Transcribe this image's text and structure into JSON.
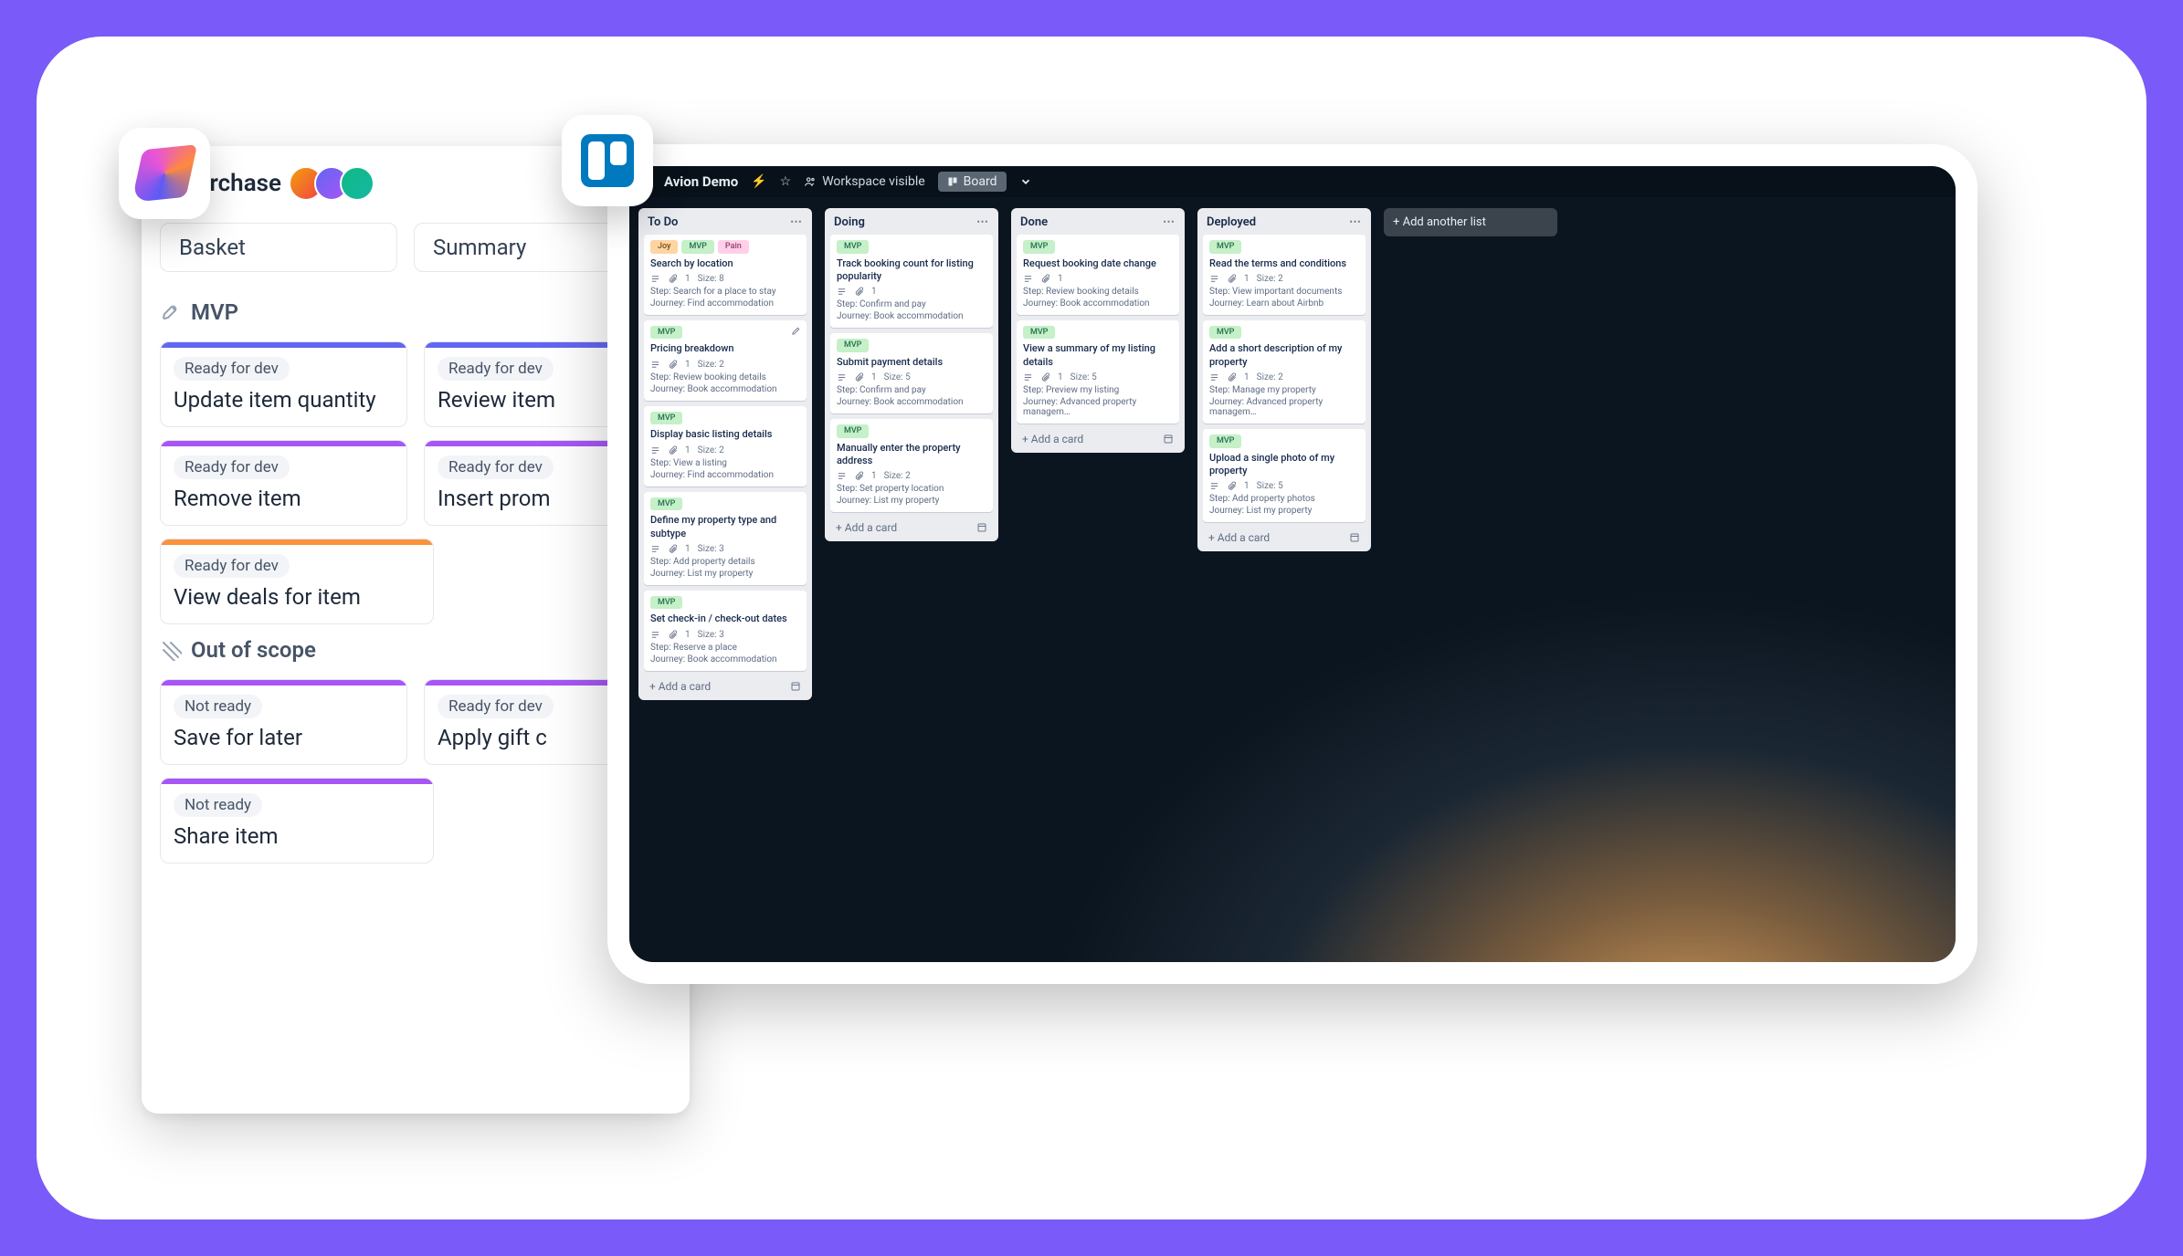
{
  "leftPanel": {
    "title": "urchase",
    "tabs": [
      "Basket",
      "Summary"
    ],
    "sections": [
      {
        "name": "MVP",
        "icon": "rocket",
        "rows": [
          [
            {
              "barColor": "indigo",
              "chip": "Ready for dev",
              "title": "Update item quantity"
            },
            {
              "barColor": "indigo",
              "chip": "Ready for dev",
              "title": "Review item"
            }
          ],
          [
            {
              "barColor": "purple",
              "chip": "Ready for dev",
              "title": "Remove item"
            },
            {
              "barColor": "purple",
              "chip": "Ready for dev",
              "title": "Insert prom"
            }
          ],
          [
            {
              "barColor": "orange",
              "chip": "Ready for dev",
              "title": "View deals for item"
            }
          ]
        ]
      },
      {
        "name": "Out of scope",
        "icon": "crosshatch",
        "rows": [
          [
            {
              "barColor": "purple",
              "chip": "Not ready",
              "title": "Save for later"
            },
            {
              "barColor": "purple",
              "chip": "Ready for dev",
              "title": "Apply gift c"
            }
          ],
          [
            {
              "barColor": "purple",
              "chip": "Not ready",
              "title": "Share item"
            }
          ]
        ]
      }
    ]
  },
  "trello": {
    "boardName": "Avion Demo",
    "visibility": "Workspace visible",
    "viewLabel": "Board",
    "addListLabel": "+ Add another list",
    "addCardLabel": "+  Add a card",
    "lists": [
      {
        "name": "To Do",
        "cards": [
          {
            "labels": [
              {
                "text": "Joy",
                "color": "orange"
              },
              {
                "text": "MVP",
                "color": "green"
              },
              {
                "text": "Pain",
                "color": "pink"
              }
            ],
            "title": "Search by location",
            "attachments": 1,
            "size": "Size: 8",
            "step": "Step: Search for a place to stay",
            "journey": "Journey: Find accommodation"
          },
          {
            "labels": [
              {
                "text": "MVP",
                "color": "green"
              }
            ],
            "title": "Pricing breakdown",
            "editing": true,
            "attachments": 1,
            "size": "Size: 2",
            "step": "Step: Review booking details",
            "journey": "Journey: Book accommodation"
          },
          {
            "labels": [
              {
                "text": "MVP",
                "color": "green"
              }
            ],
            "title": "Display basic listing details",
            "attachments": 1,
            "size": "Size: 2",
            "step": "Step: View a listing",
            "journey": "Journey: Find accommodation"
          },
          {
            "labels": [
              {
                "text": "MVP",
                "color": "green"
              }
            ],
            "title": "Define my property type and subtype",
            "attachments": 1,
            "size": "Size: 3",
            "step": "Step: Add property details",
            "journey": "Journey: List my property"
          },
          {
            "labels": [
              {
                "text": "MVP",
                "color": "green"
              }
            ],
            "title": "Set check-in / check-out dates",
            "attachments": 1,
            "size": "Size: 3",
            "step": "Step: Reserve a place",
            "journey": "Journey: Book accommodation"
          }
        ]
      },
      {
        "name": "Doing",
        "cards": [
          {
            "labels": [
              {
                "text": "MVP",
                "color": "green"
              }
            ],
            "title": "Track booking count for listing popularity",
            "attachments": 1,
            "size": "",
            "step": "Step: Confirm and pay",
            "journey": "Journey: Book accommodation"
          },
          {
            "labels": [
              {
                "text": "MVP",
                "color": "green"
              }
            ],
            "title": "Submit payment details",
            "attachments": 1,
            "size": "Size: 5",
            "step": "Step: Confirm and pay",
            "journey": "Journey: Book accommodation"
          },
          {
            "labels": [
              {
                "text": "MVP",
                "color": "green"
              }
            ],
            "title": "Manually enter the property address",
            "attachments": 1,
            "size": "Size: 2",
            "step": "Step: Set property location",
            "journey": "Journey: List my property"
          }
        ]
      },
      {
        "name": "Done",
        "cards": [
          {
            "labels": [
              {
                "text": "MVP",
                "color": "green"
              }
            ],
            "title": "Request booking date change",
            "attachments": 1,
            "size": "",
            "step": "Step: Review booking details",
            "journey": "Journey: Book accommodation"
          },
          {
            "labels": [
              {
                "text": "MVP",
                "color": "green"
              }
            ],
            "title": "View a summary of my listing details",
            "attachments": 1,
            "size": "Size: 5",
            "step": "Step: Preview my listing",
            "journey": "Journey: Advanced property managem…"
          }
        ]
      },
      {
        "name": "Deployed",
        "cards": [
          {
            "labels": [
              {
                "text": "MVP",
                "color": "green"
              }
            ],
            "title": "Read the terms and conditions",
            "attachments": 1,
            "size": "Size: 2",
            "step": "Step: View important documents",
            "journey": "Journey: Learn about Airbnb"
          },
          {
            "labels": [
              {
                "text": "MVP",
                "color": "green"
              }
            ],
            "title": "Add a short description of my property",
            "attachments": 1,
            "size": "Size: 2",
            "step": "Step: Manage my property",
            "journey": "Journey: Advanced property managem…"
          },
          {
            "labels": [
              {
                "text": "MVP",
                "color": "green"
              }
            ],
            "title": "Upload a single photo of my property",
            "attachments": 1,
            "size": "Size: 5",
            "step": "Step: Add property photos",
            "journey": "Journey: List my property"
          }
        ]
      }
    ]
  }
}
